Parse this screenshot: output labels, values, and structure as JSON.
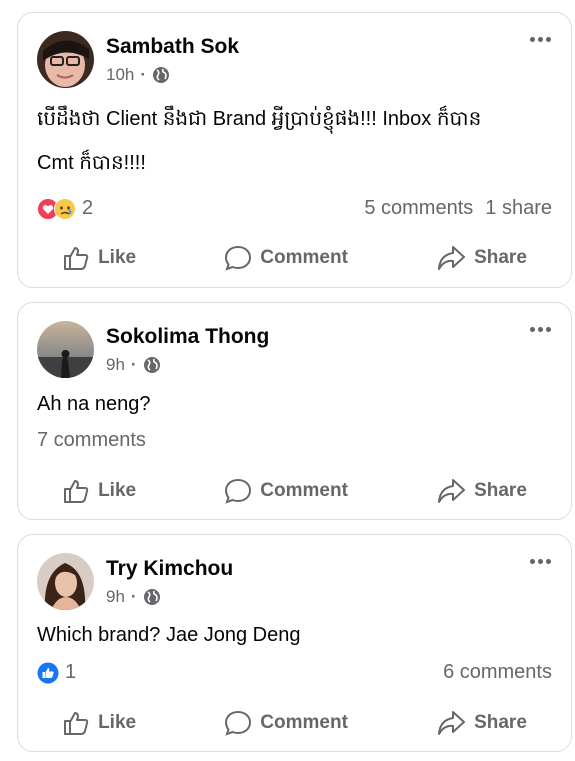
{
  "actions": {
    "like": "Like",
    "comment": "Comment",
    "share": "Share"
  },
  "posts": [
    {
      "author": "Sambath Sok",
      "time": "10h",
      "privacy_icon": "globe-icon",
      "text_line1": "បើដឹងថា Client នឹងជា Brand អ្វីប្រាប់ខ្ញុំផង!!! Inbox ក៏បាន",
      "text_line2": "Cmt ក៏បាន!!!!",
      "reactions": [
        "love",
        "care-sad"
      ],
      "reaction_count": "2",
      "comments": "5 comments",
      "shares": "1 share"
    },
    {
      "author": "Sokolima Thong",
      "time": "9h",
      "privacy_icon": "globe-icon",
      "text": "Ah na neng?",
      "comments": "7 comments"
    },
    {
      "author": "Try Kimchou",
      "time": "9h",
      "privacy_icon": "globe-icon",
      "text": "Which brand? Jae Jong Deng",
      "reactions": [
        "like"
      ],
      "reaction_count": "1",
      "comments": "6 comments"
    }
  ],
  "colors": {
    "muted": "#65676b",
    "love": "#f33e58",
    "like": "#1877f2",
    "border": "#dcdde1"
  }
}
